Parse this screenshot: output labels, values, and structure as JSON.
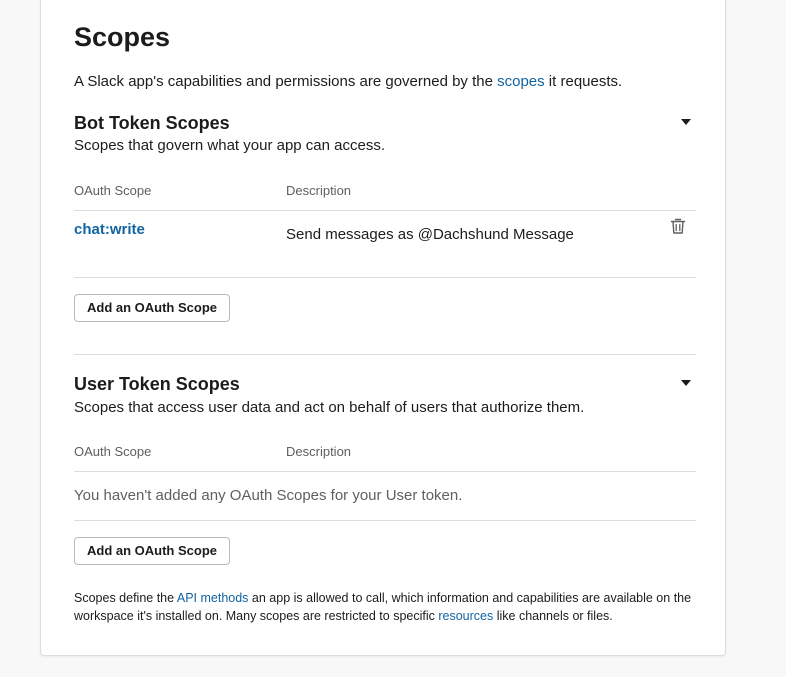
{
  "scopes": {
    "title": "Scopes",
    "intro_before": "A Slack app's capabilities and permissions are governed by the ",
    "intro_link": "scopes",
    "intro_after": " it requests."
  },
  "bot_section": {
    "title": "Bot Token Scopes",
    "subtitle": "Scopes that govern what your app can access.",
    "col_scope": "OAuth Scope",
    "col_description": "Description",
    "rows": [
      {
        "scope": "chat:write",
        "description": "Send messages as @Dachshund Message",
        "action_icon": "trash-icon"
      }
    ],
    "add_button": "Add an OAuth Scope"
  },
  "user_section": {
    "title": "User Token Scopes",
    "subtitle": "Scopes that access user data and act on behalf of users that authorize them.",
    "col_scope": "OAuth Scope",
    "col_description": "Description",
    "empty_message": "You haven't added any OAuth Scopes for your User token.",
    "add_button": "Add an OAuth Scope"
  },
  "footnote": {
    "part1": "Scopes define the ",
    "link1": "API methods",
    "part2": " an app is allowed to call, which information and capabilities are available on the workspace it's installed on. Many scopes are restricted to specific ",
    "link2": "resources",
    "part3": " like channels or files."
  },
  "colors": {
    "link": "#1264a3",
    "text": "#1d1c1d",
    "muted": "#616061",
    "border": "#dddddd"
  }
}
